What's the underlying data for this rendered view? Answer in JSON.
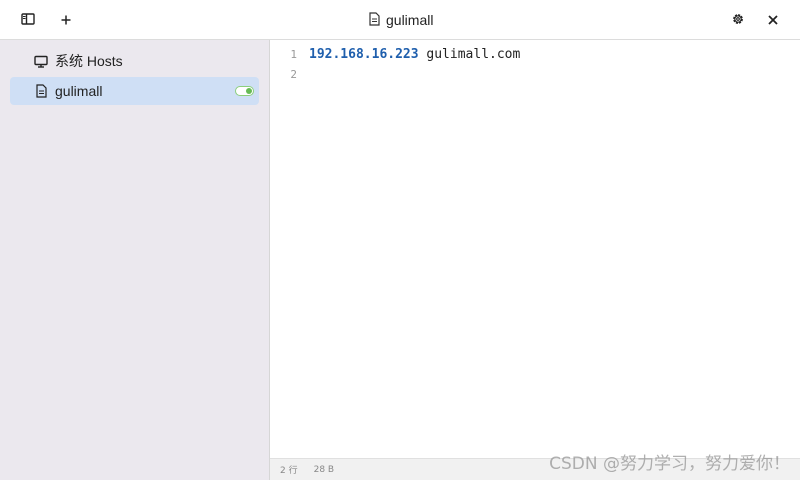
{
  "titlebar": {
    "title": "gulimall",
    "icons": {
      "sidebar_toggle": "sidebar-panel-icon",
      "add": "plus-icon",
      "file": "file-icon",
      "settings": "gear-icon",
      "close": "close-icon"
    }
  },
  "sidebar": {
    "items": [
      {
        "label": "系统 Hosts",
        "icon": "monitor-icon",
        "active": false
      },
      {
        "label": "gulimall",
        "icon": "file-icon",
        "active": true,
        "enabled": true
      }
    ]
  },
  "editor": {
    "lines": [
      {
        "number": "1",
        "ip": "192.168.16.223",
        "host": " gulimall.com"
      },
      {
        "number": "2",
        "ip": "",
        "host": ""
      }
    ]
  },
  "statusbar": {
    "lines": "2 行",
    "size": "28 B"
  },
  "watermark": "CSDN @努力学习，努力爱你！",
  "colors": {
    "sidebar_bg": "#ebe8ee",
    "active_item_bg": "#cfdff5",
    "ip_color": "#1f5fad",
    "toggle_on": "#66bb55"
  }
}
